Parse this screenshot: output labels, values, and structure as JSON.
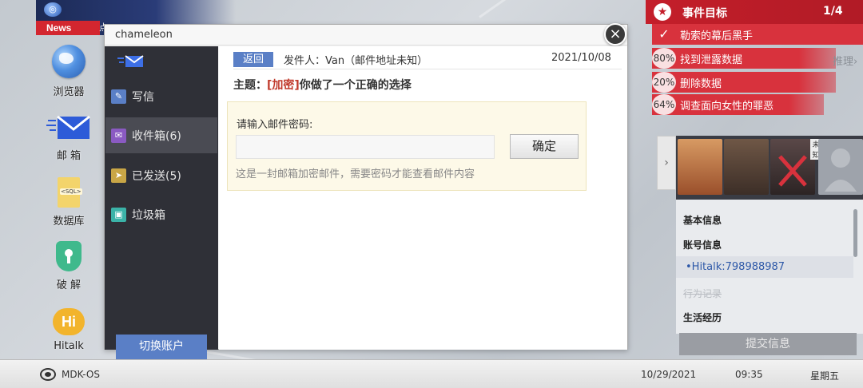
{
  "news": {
    "label": "News",
    "ticker": "点"
  },
  "desktop_icons": [
    {
      "label": "浏览器",
      "icon": "globe-icon"
    },
    {
      "label": "邮 箱",
      "icon": "mail-icon"
    },
    {
      "label": "数据库",
      "icon": "sql-file-icon",
      "badge": "<SQL>"
    },
    {
      "label": "破 解",
      "icon": "shield-key-icon"
    },
    {
      "label": "Hitalk",
      "icon": "hitalk-icon",
      "badge": "Hi"
    }
  ],
  "window": {
    "title": "chameleon",
    "close_label": "×",
    "sidebar": {
      "items": [
        {
          "label": "写信",
          "icon": "compose-icon",
          "color": "#5a7fc6"
        },
        {
          "label": "收件箱(6)",
          "icon": "inbox-icon",
          "color": "#8a5ac2",
          "active": true
        },
        {
          "label": "已发送(5)",
          "icon": "sent-icon",
          "color": "#c9a646"
        },
        {
          "label": "垃圾箱",
          "icon": "trash-icon",
          "color": "#3bb3a8"
        }
      ],
      "switch_account": "切换账户"
    },
    "message": {
      "back_label": "返回",
      "sender": "发件人：Van（邮件地址未知）",
      "date": "2021/10/08",
      "subject_prefix": "主题：",
      "subject_tag": "[加密]",
      "subject_text": "你做了一个正确的选择",
      "password_label": "请输入邮件密码:",
      "password_value": "",
      "confirm_label": "确定",
      "hint": "这是一封邮箱加密邮件，需要密码才能查看邮件内容"
    }
  },
  "mission": {
    "title": "事件目标",
    "count": "1/4",
    "objectives": [
      {
        "text": "勒索的幕后黑手",
        "status": "done"
      },
      {
        "text": "找到泄露数据",
        "progress": "80%"
      },
      {
        "text": "删除数据",
        "progress": "20%"
      },
      {
        "text": "调查面向女性的罪恶",
        "progress": "64%"
      }
    ],
    "reason_link": "推理›",
    "accent": "#c41e2a"
  },
  "profile": {
    "expand_label": "›",
    "portrait_tag": "未知",
    "info": {
      "basic": "基本信息",
      "account": "账号信息",
      "hitalk": "•Hitalk:798988987",
      "behavior": "行为记录",
      "life": "生活经历"
    },
    "submit": "提交信息"
  },
  "taskbar": {
    "os": "MDK-OS",
    "date": "10/29/2021",
    "time": "09:35",
    "day": "星期五"
  }
}
